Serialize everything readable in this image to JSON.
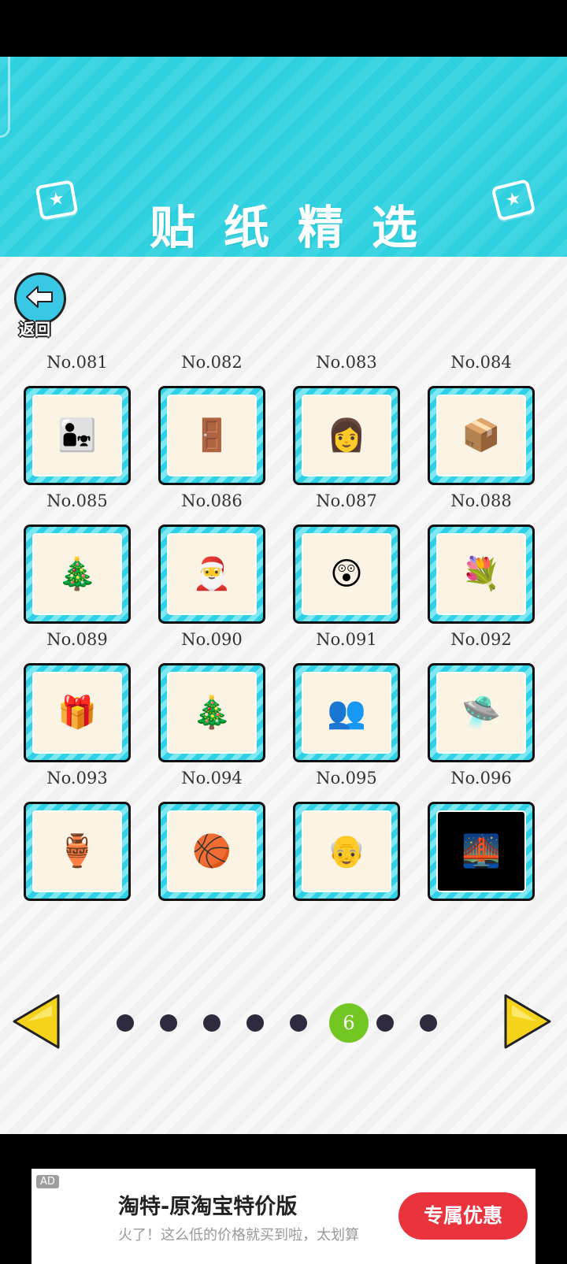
{
  "header": {
    "title": "贴纸精选"
  },
  "back": {
    "label": "返回"
  },
  "stickers": [
    {
      "label": "No.081",
      "icon": "family-park-icon",
      "glyph": "👨‍👧"
    },
    {
      "label": "No.082",
      "icon": "boy-at-door-icon",
      "glyph": "🚪"
    },
    {
      "label": "No.083",
      "icon": "woman-in-doorway-icon",
      "glyph": "👩"
    },
    {
      "label": "No.084",
      "icon": "delivery-icon",
      "glyph": "📦"
    },
    {
      "label": "No.085",
      "icon": "christmas-wreath-icon",
      "glyph": "🎄"
    },
    {
      "label": "No.086",
      "icon": "santa-thought-icon",
      "glyph": "🎅"
    },
    {
      "label": "No.087",
      "icon": "boy-surprised-icon",
      "glyph": "😲"
    },
    {
      "label": "No.088",
      "icon": "boy-with-flowers-icon",
      "glyph": "💐"
    },
    {
      "label": "No.089",
      "icon": "gift-thought-icon",
      "glyph": "🎁"
    },
    {
      "label": "No.090",
      "icon": "christmas-party-icon",
      "glyph": "🎄"
    },
    {
      "label": "No.091",
      "icon": "classroom-friends-icon",
      "glyph": "👥"
    },
    {
      "label": "No.092",
      "icon": "ufo-window-icon",
      "glyph": "🛸"
    },
    {
      "label": "No.093",
      "icon": "vase-room-icon",
      "glyph": "🏺"
    },
    {
      "label": "No.094",
      "icon": "basketball-crowd-icon",
      "glyph": "🏀"
    },
    {
      "label": "No.095",
      "icon": "principal-podium-icon",
      "glyph": "👴"
    },
    {
      "label": "No.096",
      "icon": "dark-bridge-icon",
      "glyph": "🌉"
    }
  ],
  "pager": {
    "current": "6",
    "total_dots": 8
  },
  "ad": {
    "badge": "AD",
    "title": "淘特-原淘宝特价版",
    "description": "火了！这么低的价格就买到啦，太划算",
    "button": "专属优惠"
  },
  "colors": {
    "header": "#2fd1e0",
    "frame": "#2fd1e6",
    "active_dot": "#73c722",
    "arrow": "#f5d31a",
    "ad_button": "#e9343e"
  }
}
